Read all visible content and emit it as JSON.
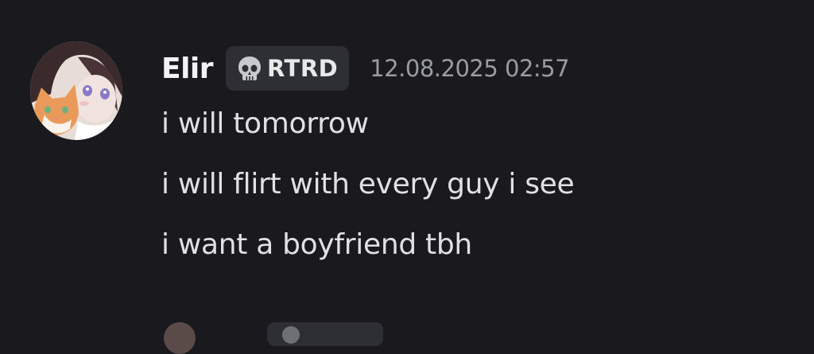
{
  "message": {
    "username": "Elir",
    "tag": {
      "icon": "skull-icon",
      "text": "RTRD"
    },
    "timestamp": "12.08.2025 02:57",
    "lines": [
      "i will tomorrow",
      "i will flirt with every guy i see",
      "i want a boyfriend tbh"
    ]
  },
  "colors": {
    "background": "#1a1a1e",
    "username": "#f2f3f5",
    "tag_background": "#2e2f34",
    "timestamp": "#9a9ca3",
    "message_text": "#dfe1e5"
  }
}
